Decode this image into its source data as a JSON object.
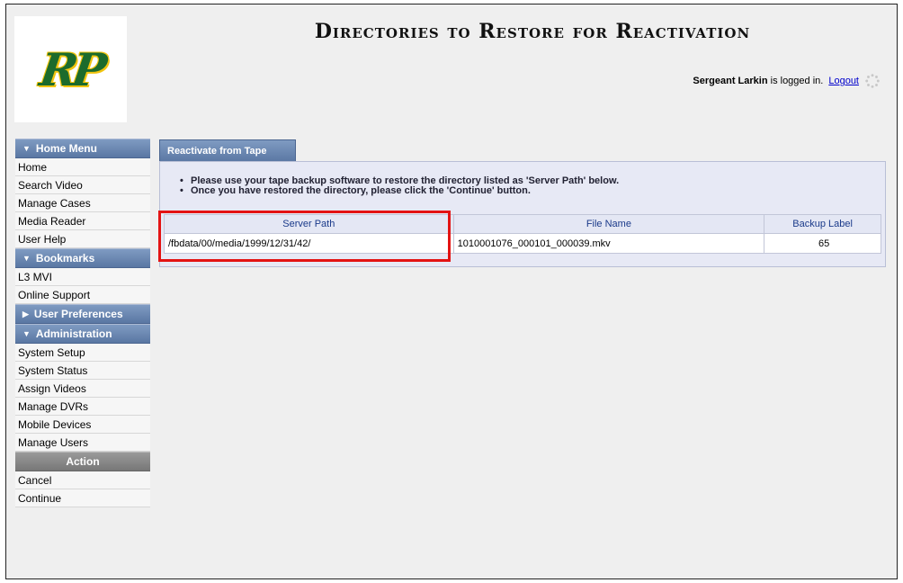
{
  "header": {
    "logo_text": "RP",
    "title": "Directories to Restore for Reactivation",
    "user_name": "Sergeant Larkin",
    "logged_in_text": "is logged in.",
    "logout_label": "Logout"
  },
  "sidebar": {
    "home_menu": {
      "title": "Home Menu",
      "items": [
        "Home",
        "Search Video",
        "Manage Cases",
        "Media Reader",
        "User Help"
      ]
    },
    "bookmarks": {
      "title": "Bookmarks",
      "items": [
        "L3 MVI",
        "Online Support"
      ]
    },
    "user_preferences": {
      "title": "User Preferences"
    },
    "administration": {
      "title": "Administration",
      "items": [
        "System Setup",
        "System Status",
        "Assign Videos",
        "Manage DVRs",
        "Mobile Devices",
        "Manage Users"
      ]
    },
    "action": {
      "title": "Action",
      "items": [
        "Cancel",
        "Continue"
      ]
    }
  },
  "main": {
    "tab_label": "Reactivate from Tape",
    "instructions": [
      "Please use your tape backup software to restore the directory listed as 'Server Path' below.",
      "Once you have restored the directory, please click the 'Continue' button."
    ],
    "table": {
      "headers": [
        "Server Path",
        "File Name",
        "Backup Label"
      ],
      "rows": [
        [
          "/fbdata/00/media/1999/12/31/42/",
          "1010001076_000101_000039.mkv",
          "65"
        ]
      ]
    }
  },
  "colors": {
    "menu_header": "#6c89b3",
    "highlight": "#e31313",
    "logo_green": "#1c6b2c",
    "logo_gold": "#f1c40f"
  }
}
